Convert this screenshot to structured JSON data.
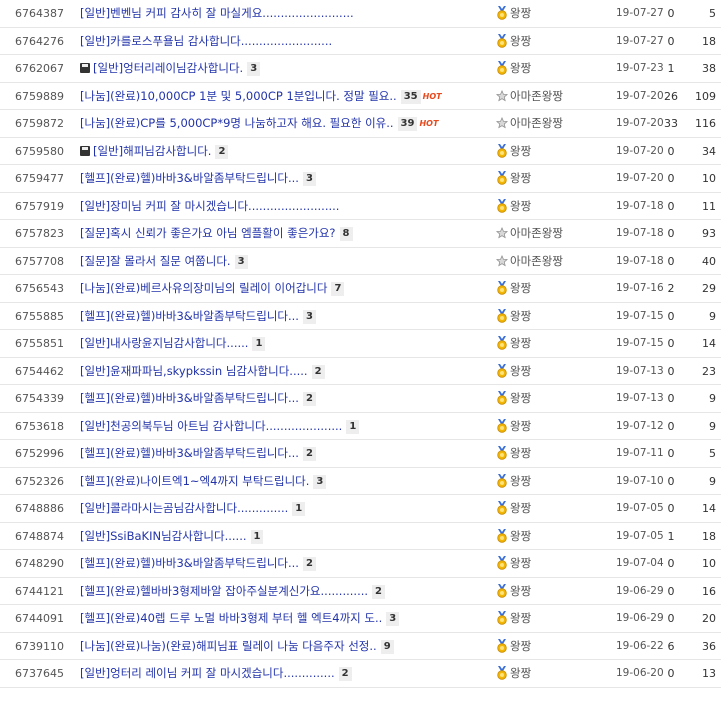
{
  "rows": [
    {
      "num": "6764387",
      "title": "[일반]벤벤님 커피 감사히 잘 마실게요.........................",
      "count": "",
      "hot": false,
      "disk": false,
      "author": "왕짱",
      "icon": "medal",
      "date": "19-07-27",
      "rec": "0",
      "views": "5"
    },
    {
      "num": "6764276",
      "title": "[일반]카를로스푸욜님 감사합니다.........................",
      "count": "",
      "hot": false,
      "disk": false,
      "author": "왕짱",
      "icon": "medal",
      "date": "19-07-27",
      "rec": "0",
      "views": "18"
    },
    {
      "num": "6762067",
      "title": "엉터리레이님감사합니다.",
      "count": "3",
      "hot": false,
      "disk": true,
      "prefix": "[일반]",
      "author": "왕짱",
      "icon": "medal",
      "date": "19-07-23",
      "rec": "1",
      "views": "38"
    },
    {
      "num": "6759889",
      "title": "[나눔](완료)10,000CP 1분 및 5,000CP 1분입니다. 정말 필요..",
      "count": "35",
      "hot": true,
      "disk": false,
      "author": "아마존왕짱",
      "icon": "star",
      "date": "19-07-20",
      "rec": "26",
      "views": "109"
    },
    {
      "num": "6759872",
      "title": "[나눔](완료)CP를 5,000CP*9명 나눔하고자 해요. 필요한 이유..",
      "count": "39",
      "hot": true,
      "disk": false,
      "author": "아마존왕짱",
      "icon": "star",
      "date": "19-07-20",
      "rec": "33",
      "views": "116"
    },
    {
      "num": "6759580",
      "title": "해피님감사합니다.",
      "count": "2",
      "hot": false,
      "disk": true,
      "prefix": "[일반]",
      "author": "왕짱",
      "icon": "medal",
      "date": "19-07-20",
      "rec": "0",
      "views": "34"
    },
    {
      "num": "6759477",
      "title": "[헬프](완료)헬)바바3&바알좀부탁드립니다...",
      "count": "3",
      "hot": false,
      "disk": false,
      "author": "왕짱",
      "icon": "medal",
      "date": "19-07-20",
      "rec": "0",
      "views": "10"
    },
    {
      "num": "6757919",
      "title": "[일반]장미님 커피 잘 마시겠습니다.........................",
      "count": "",
      "hot": false,
      "disk": false,
      "author": "왕짱",
      "icon": "medal",
      "date": "19-07-18",
      "rec": "0",
      "views": "11"
    },
    {
      "num": "6757823",
      "title": "[질문]혹시 신뢰가 좋은가요 아님 엠플활이 좋은가요?",
      "count": "8",
      "hot": false,
      "disk": false,
      "author": "아마존왕짱",
      "icon": "star",
      "date": "19-07-18",
      "rec": "0",
      "views": "93"
    },
    {
      "num": "6757708",
      "title": "[질문]잘 몰라서 질문 여쭙니다.",
      "count": "3",
      "hot": false,
      "disk": false,
      "author": "아마존왕짱",
      "icon": "star",
      "date": "19-07-18",
      "rec": "0",
      "views": "40"
    },
    {
      "num": "6756543",
      "title": "[나눔](완료)베르사유의장미님의 릴레이 이어갑니다",
      "count": "7",
      "hot": false,
      "disk": false,
      "author": "왕짱",
      "icon": "medal",
      "date": "19-07-16",
      "rec": "2",
      "views": "29"
    },
    {
      "num": "6755885",
      "title": "[헬프](완료)헬)바바3&바알좀부탁드립니다...",
      "count": "3",
      "hot": false,
      "disk": false,
      "author": "왕짱",
      "icon": "medal",
      "date": "19-07-15",
      "rec": "0",
      "views": "9"
    },
    {
      "num": "6755851",
      "title": "[일반]내사랑윤지님감사합니다......",
      "count": "1",
      "hot": false,
      "disk": false,
      "author": "왕짱",
      "icon": "medal",
      "date": "19-07-15",
      "rec": "0",
      "views": "14"
    },
    {
      "num": "6754462",
      "title": "[일반]윤재파파님,skypkssin 님감사합니다.....",
      "count": "2",
      "hot": false,
      "disk": false,
      "author": "왕짱",
      "icon": "medal",
      "date": "19-07-13",
      "rec": "0",
      "views": "23"
    },
    {
      "num": "6754339",
      "title": "[헬프](완료)헬)바바3&바알좀부탁드립니다...",
      "count": "2",
      "hot": false,
      "disk": false,
      "author": "왕짱",
      "icon": "medal",
      "date": "19-07-13",
      "rec": "0",
      "views": "9"
    },
    {
      "num": "6753618",
      "title": "[일반]천공의북두님 아트님 감사합니다.....................",
      "count": "1",
      "hot": false,
      "disk": false,
      "author": "왕짱",
      "icon": "medal",
      "date": "19-07-12",
      "rec": "0",
      "views": "9"
    },
    {
      "num": "6752996",
      "title": "[헬프](완료)헬)바바3&바알좀부탁드립니다...",
      "count": "2",
      "hot": false,
      "disk": false,
      "author": "왕짱",
      "icon": "medal",
      "date": "19-07-11",
      "rec": "0",
      "views": "5"
    },
    {
      "num": "6752326",
      "title": "[헬프](완료)나이트엑1~엑4까지 부탁드립니다.",
      "count": "3",
      "hot": false,
      "disk": false,
      "author": "왕짱",
      "icon": "medal",
      "date": "19-07-10",
      "rec": "0",
      "views": "9"
    },
    {
      "num": "6748886",
      "title": "[일반]콜라마시는곰님감사합니다..............",
      "count": "1",
      "hot": false,
      "disk": false,
      "author": "왕짱",
      "icon": "medal",
      "date": "19-07-05",
      "rec": "0",
      "views": "14"
    },
    {
      "num": "6748874",
      "title": "[일반]SsiBaKIN님감사합니다......",
      "count": "1",
      "hot": false,
      "disk": false,
      "author": "왕짱",
      "icon": "medal",
      "date": "19-07-05",
      "rec": "1",
      "views": "18"
    },
    {
      "num": "6748290",
      "title": "[헬프](완료)헬)바바3&바알좀부탁드립니다...",
      "count": "2",
      "hot": false,
      "disk": false,
      "author": "왕짱",
      "icon": "medal",
      "date": "19-07-04",
      "rec": "0",
      "views": "10"
    },
    {
      "num": "6744121",
      "title": "[헬프](완료)헬바바3형제바알 잡아주실분계신가요.............",
      "count": "2",
      "hot": false,
      "disk": false,
      "author": "왕짱",
      "icon": "medal",
      "date": "19-06-29",
      "rec": "0",
      "views": "16"
    },
    {
      "num": "6744091",
      "title": "[헬프](완료)40렙 드루 노멀 바바3형제 부터 헬 엑트4까지 도..",
      "count": "3",
      "hot": false,
      "disk": false,
      "author": "왕짱",
      "icon": "medal",
      "date": "19-06-29",
      "rec": "0",
      "views": "20"
    },
    {
      "num": "6739110",
      "title": "[나눔](완료)나눔)(완료)해피님표 릴레이 나눔 다음주자 선정..",
      "count": "9",
      "hot": false,
      "disk": false,
      "author": "왕짱",
      "icon": "medal",
      "date": "19-06-22",
      "rec": "6",
      "views": "36"
    },
    {
      "num": "6737645",
      "title": "[일반]엉터리 레이님 커피 잘 마시겠습니다..............",
      "count": "2",
      "hot": false,
      "disk": false,
      "author": "왕짱",
      "icon": "medal",
      "date": "19-06-20",
      "rec": "0",
      "views": "13"
    }
  ],
  "hot_label": "HOT"
}
